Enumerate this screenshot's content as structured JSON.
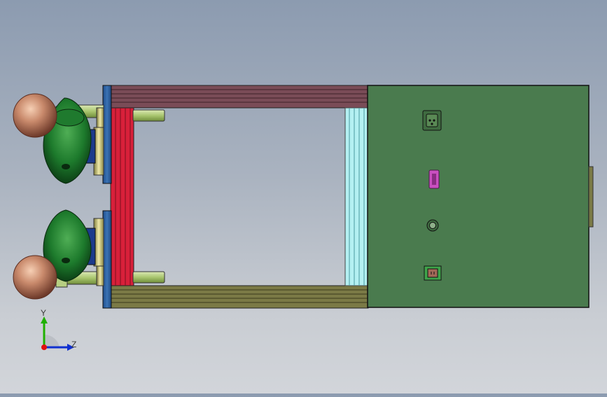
{
  "viewport": {
    "background_top": "#8c9bb0",
    "background_bottom": "#d2d5da"
  },
  "colors": {
    "electronics_box": "#4a7b4e",
    "top_rail": "#7a4c57",
    "bottom_rail": "#7b7a46",
    "left_plate": "#d8203a",
    "right_plate": "#a8eaee",
    "end_cap_blue": "#2f63a3",
    "nose_cone_green": "#1f7a2e",
    "copper_dome": "#b0705a",
    "shaft_green": "#b7cf82",
    "connector_magenta": "#c94fc0"
  },
  "components": {
    "electronics_box": "electronics-box",
    "connectors": [
      "power-connector-icon",
      "serial-port-icon",
      "round-port-icon",
      "square-port-icon"
    ]
  },
  "triad": {
    "y_label": "Y",
    "z_label": "Z",
    "y_color": "#1fb000",
    "z_color": "#1030d0",
    "x_color": "#e01010"
  }
}
